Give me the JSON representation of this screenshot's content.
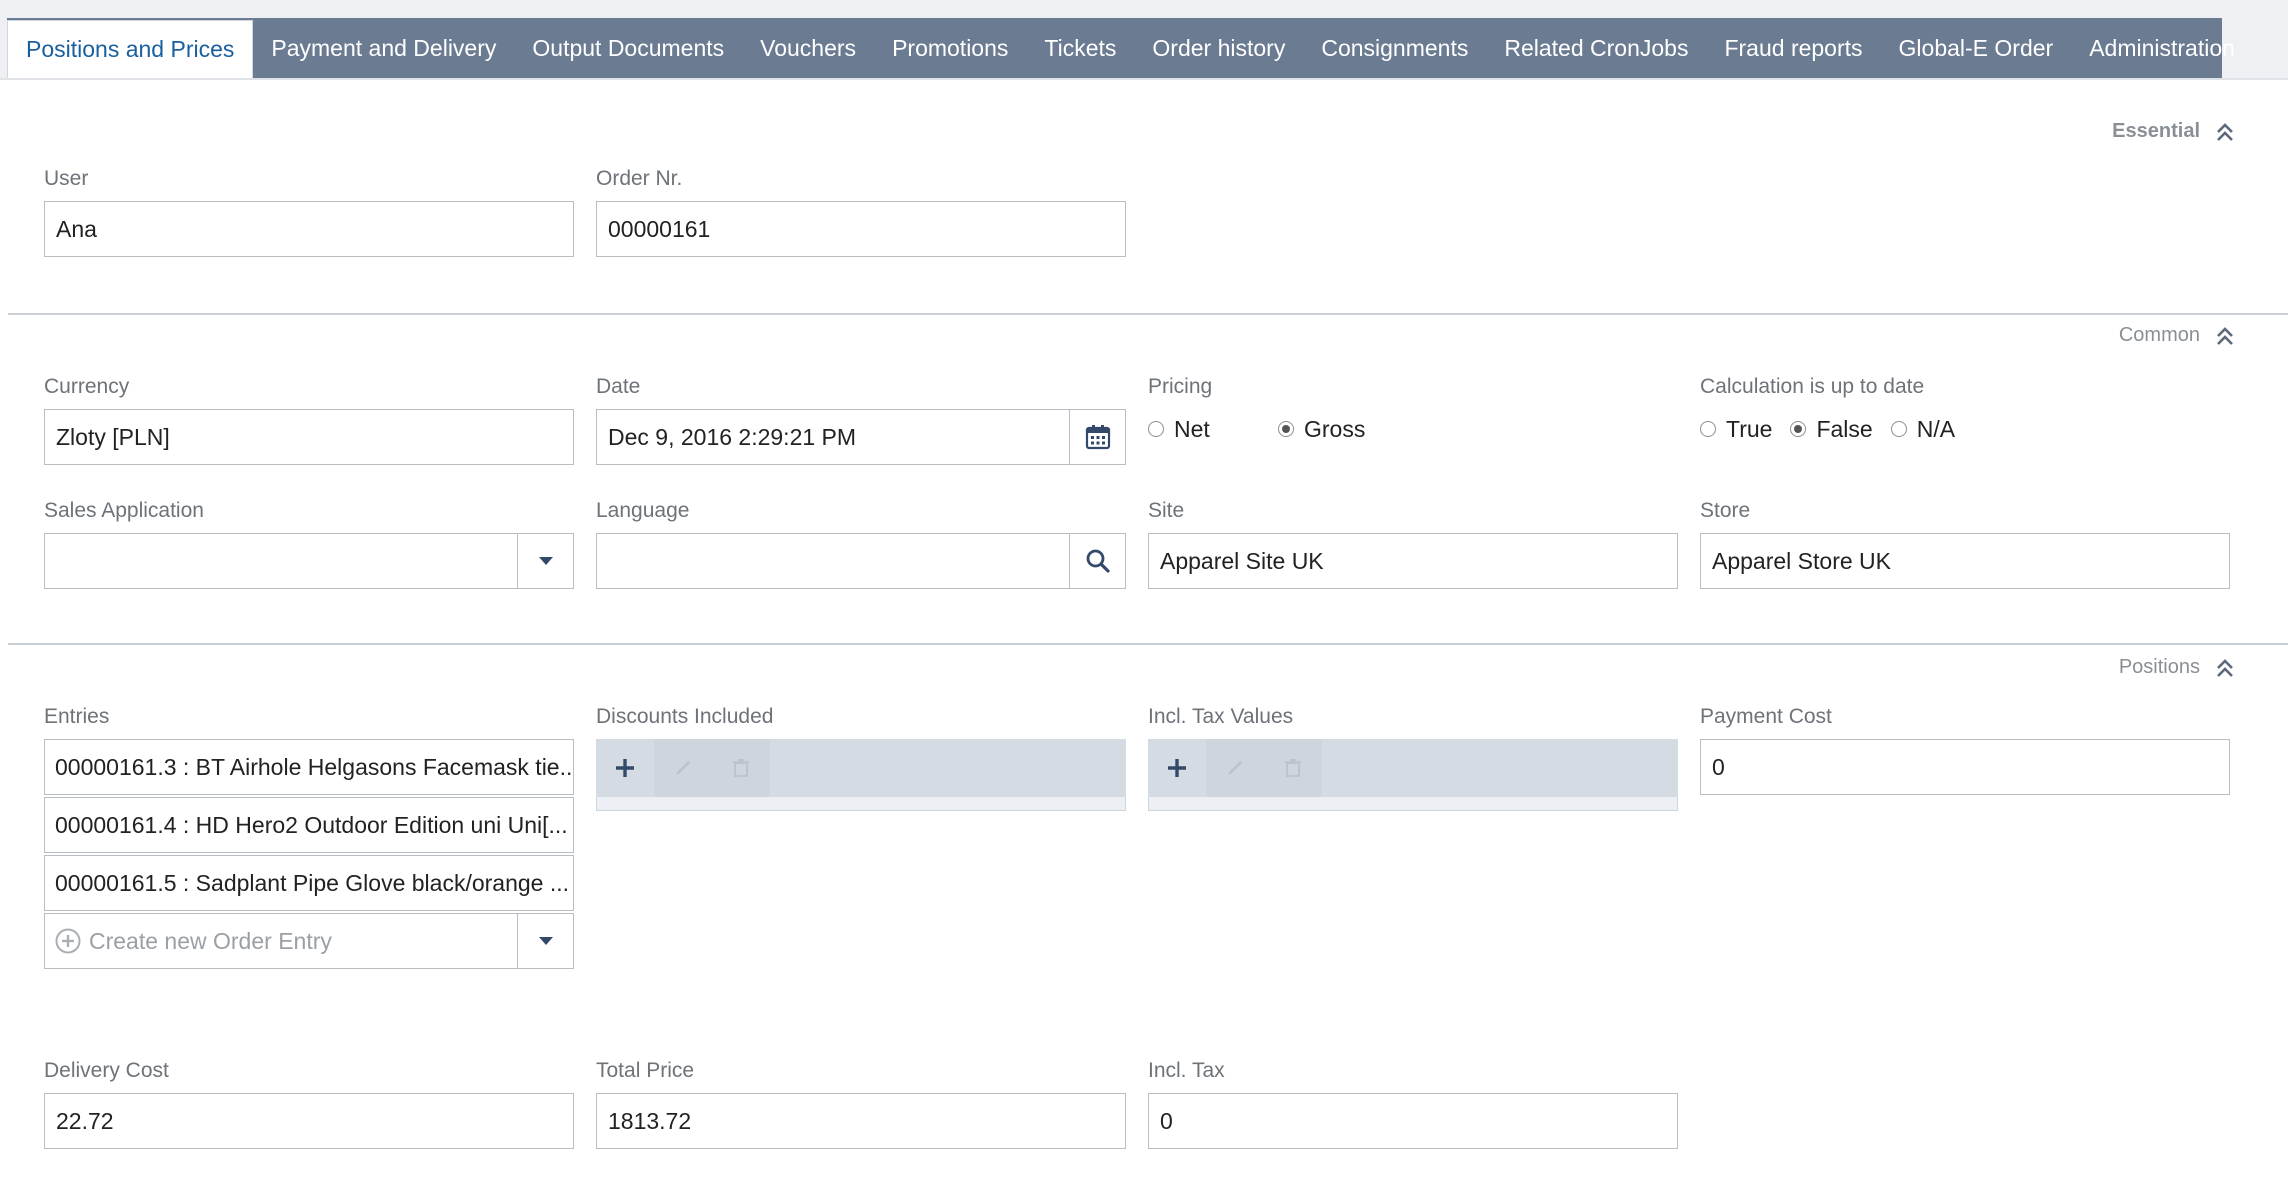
{
  "tabs": [
    {
      "label": "Positions and Prices",
      "active": true
    },
    {
      "label": "Payment and Delivery"
    },
    {
      "label": "Output Documents"
    },
    {
      "label": "Vouchers"
    },
    {
      "label": "Promotions"
    },
    {
      "label": "Tickets"
    },
    {
      "label": "Order history"
    },
    {
      "label": "Consignments"
    },
    {
      "label": "Related CronJobs"
    },
    {
      "label": "Fraud reports"
    },
    {
      "label": "Global-E Order"
    },
    {
      "label": "Administration"
    }
  ],
  "essential": {
    "header": "Essential",
    "user": {
      "label": "User",
      "value": "Ana"
    },
    "order_nr": {
      "label": "Order Nr.",
      "value": "00000161"
    }
  },
  "common": {
    "header": "Common",
    "currency": {
      "label": "Currency",
      "value": "Zloty [PLN]"
    },
    "date": {
      "label": "Date",
      "value": "Dec 9, 2016 2:29:21 PM"
    },
    "pricing": {
      "label": "Pricing",
      "options": [
        "Net",
        "Gross"
      ],
      "selected": "Gross"
    },
    "calculation": {
      "label": "Calculation is up to date",
      "options": [
        "True",
        "False",
        "N/A"
      ],
      "selected": "False"
    },
    "sales_application": {
      "label": "Sales Application",
      "value": ""
    },
    "language": {
      "label": "Language",
      "value": ""
    },
    "site": {
      "label": "Site",
      "value": "Apparel Site UK"
    },
    "store": {
      "label": "Store",
      "value": "Apparel Store UK"
    }
  },
  "positions": {
    "header": "Positions",
    "entries": {
      "label": "Entries",
      "items": [
        "00000161.3 : BT Airhole Helgasons Facemask tie...",
        "00000161.4 : HD Hero2 Outdoor Edition uni Uni[...",
        "00000161.5 : Sadplant Pipe Glove black/orange ..."
      ],
      "create_placeholder": "Create new Order Entry"
    },
    "discounts_included": {
      "label": "Discounts Included"
    },
    "incl_tax_values": {
      "label": "Incl. Tax Values"
    },
    "payment_cost": {
      "label": "Payment Cost",
      "value": "0"
    },
    "delivery_cost": {
      "label": "Delivery Cost",
      "value": "22.72"
    },
    "total_price": {
      "label": "Total Price",
      "value": "1813.72"
    },
    "incl_tax": {
      "label": "Incl. Tax",
      "value": "0"
    }
  },
  "icons": {
    "collapse": "double-chevron-up-icon",
    "calendar": "calendar-icon",
    "dropdown": "caret-down-icon",
    "search": "search-icon",
    "add": "plus-icon",
    "edit": "pencil-icon",
    "delete": "trash-icon"
  },
  "colors": {
    "tabbar": "#6a7b92",
    "active_tab_text": "#1a5fa0",
    "toolbar": "#d5dbe3",
    "icon_dark": "#33496a"
  }
}
